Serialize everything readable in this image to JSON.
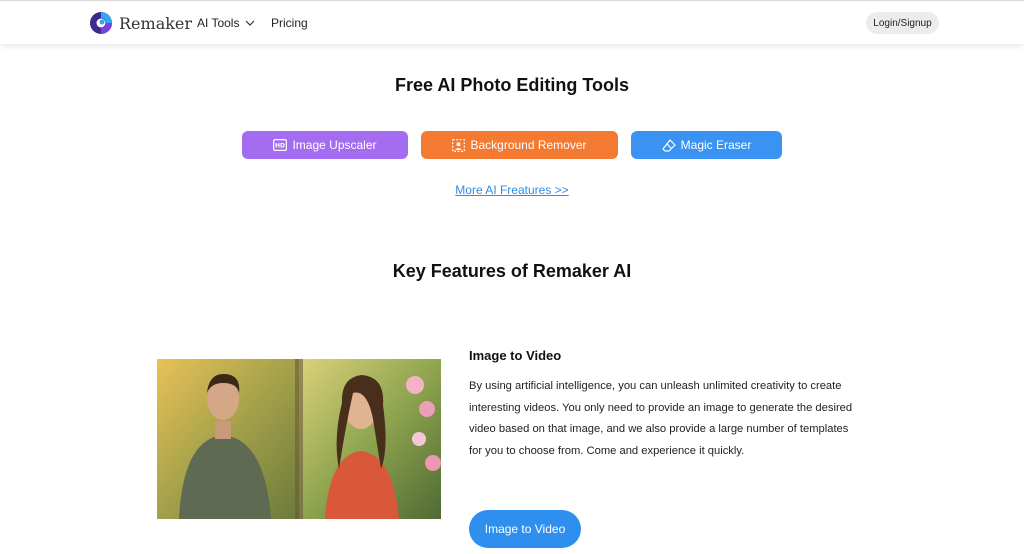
{
  "header": {
    "brand": "Remaker",
    "nav_ai_tools": "AI Tools",
    "nav_pricing": "Pricing",
    "login_label": "Login/Signup"
  },
  "tools_section": {
    "title": "Free AI Photo Editing Tools",
    "buttons": [
      {
        "label": "Image Upscaler",
        "icon": "hd-icon",
        "color": "#a46cf1"
      },
      {
        "label": "Background Remover",
        "icon": "background-remove-icon",
        "color": "#f47931"
      },
      {
        "label": "Magic Eraser",
        "icon": "eraser-icon",
        "color": "#3a92f2"
      }
    ],
    "more_link": "More AI Freatures >>"
  },
  "features_section": {
    "title": "Key Features of Remaker AI",
    "feature": {
      "title": "Image to Video",
      "description": "By using artificial intelligence, you can unleash unlimited creativity to create interesting videos. You only need to provide an image to generate the desired video based on that image, and we also provide a large number of templates for you to choose from. Come and experience it quickly.",
      "cta_label": "Image to Video"
    }
  },
  "colors": {
    "accent_blue": "#2f8fef",
    "link_blue": "#2f8de4"
  }
}
